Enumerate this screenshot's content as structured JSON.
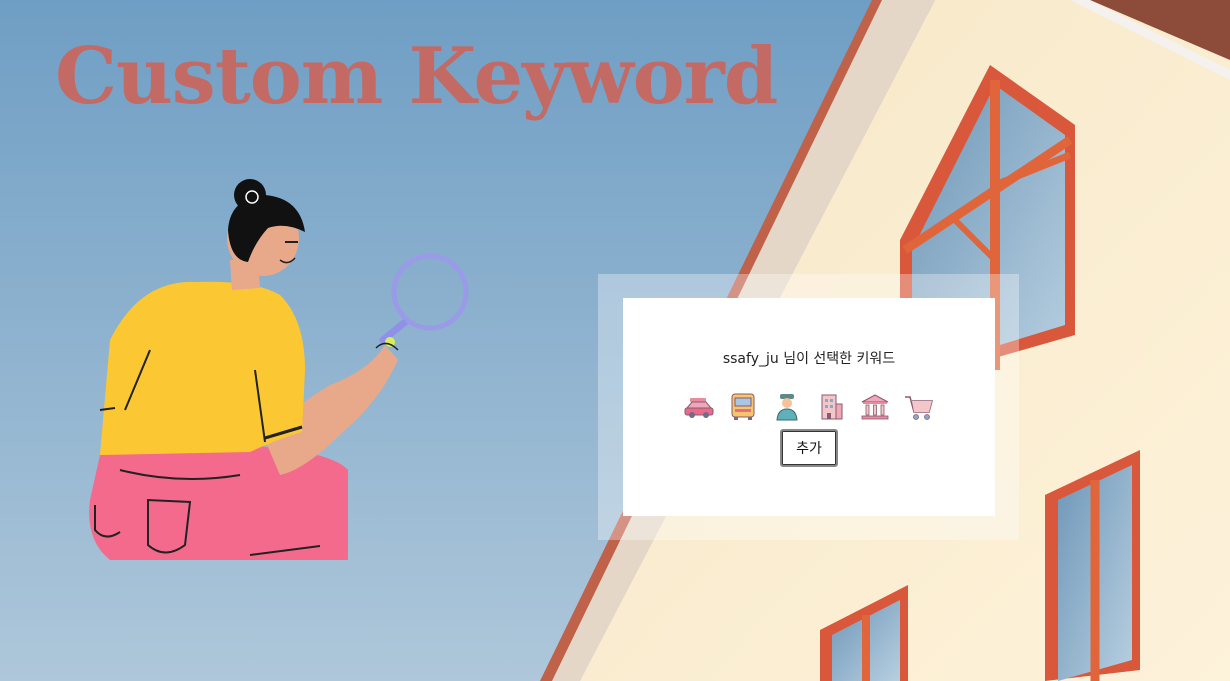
{
  "page": {
    "title": "Custom Keyword"
  },
  "card": {
    "heading": "ssafy_ju 님이 선택한 키워드",
    "add_label": "추가",
    "keywords": [
      {
        "icon": "car-icon"
      },
      {
        "icon": "bus-icon"
      },
      {
        "icon": "person-icon"
      },
      {
        "icon": "apartment-building-icon"
      },
      {
        "icon": "bank-icon"
      },
      {
        "icon": "shopping-cart-icon"
      }
    ]
  },
  "colors": {
    "title": "#c46a64",
    "sky_top": "#6f9ec4",
    "sky_bottom": "#aec7da",
    "wall": "#fbefd4",
    "window_frame": "#e0653a"
  }
}
